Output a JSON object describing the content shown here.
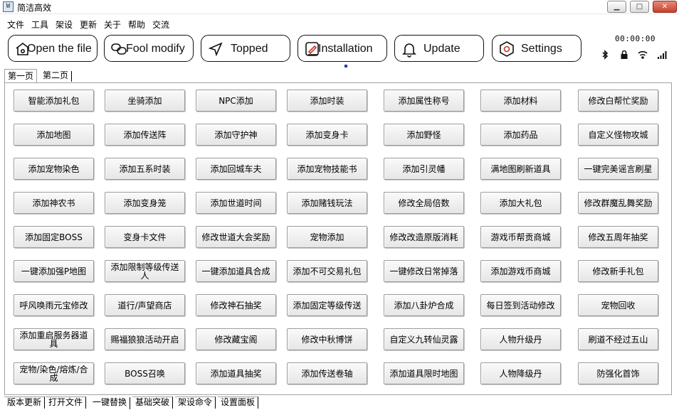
{
  "window": {
    "title": "简洁高效",
    "icon_text": "W",
    "min_label": "▁",
    "max_label": "□",
    "close_label": "✕"
  },
  "menu": [
    "文件",
    "工具",
    "架设",
    "更新",
    "关于",
    "帮助",
    "交流"
  ],
  "toolbar": [
    {
      "label": "Open the file",
      "icon": "folder-icon"
    },
    {
      "label": "Fool modify",
      "icon": "link-icon"
    },
    {
      "label": "Topped",
      "icon": "location-icon"
    },
    {
      "label": "Installation",
      "icon": "edit-icon"
    },
    {
      "label": "Update",
      "icon": "bell-icon"
    },
    {
      "label": "Settings",
      "icon": "hexagon-icon"
    }
  ],
  "status": {
    "time": "00:00:00",
    "icons": [
      "bluetooth-icon",
      "lock-icon",
      "wifi-icon",
      "signal-icon"
    ]
  },
  "top_tabs": [
    "第一页",
    "第二页"
  ],
  "grid": [
    [
      "智能添加礼包",
      "坐骑添加",
      "NPC添加",
      "添加时装",
      "添加属性称号",
      "添加材料",
      "修改白帮忙奖励"
    ],
    [
      "添加地图",
      "添加传送阵",
      "添加守护神",
      "添加变身卡",
      "添加野怪",
      "添加药品",
      "自定义怪物攻城"
    ],
    [
      "添加宠物染色",
      "添加五系时装",
      "添加回城车夫",
      "添加宠物技能书",
      "添加引灵幡",
      "满地图刷新道具",
      "一键完美谣言刷星"
    ],
    [
      "添加神农书",
      "添加变身笼",
      "添加世道时间",
      "添加赌钱玩法",
      "修改全局倍数",
      "添加大礼包",
      "修改群魔乱舞奖励"
    ],
    [
      "添加固定BOSS",
      "变身卡文件",
      "修改世道大会奖励",
      "宠物添加",
      "修改改造原版消耗",
      "游戏币帮贡商城",
      "修改五周年抽奖"
    ],
    [
      "一键添加强P地图",
      "添加限制等级传送人",
      "一键添加道具合成",
      "添加不可交易礼包",
      "一键修改日常掉落",
      "添加游戏币商城",
      "修改新手礼包"
    ],
    [
      "呼风唤雨元宝修改",
      "道行/声望商店",
      "修改神石抽奖",
      "添加固定等级传送",
      "添加八卦炉合成",
      "每日签到活动修改",
      "宠物回收"
    ],
    [
      "添加重启服务器道具",
      "赐福狼狼活动开启",
      "修改藏宝阁",
      "修改中秋博饼",
      "自定义九转仙灵露",
      "人物升级丹",
      "刷道不经过五山"
    ],
    [
      "宠物/染色/熔炼/合成",
      "BOSS召唤",
      "添加道具抽奖",
      "添加传送卷轴",
      "添加道具限时地图",
      "人物降级丹",
      "防强化首饰"
    ]
  ],
  "bottom_tabs": [
    "版本更新",
    "打开文件",
    "一键替换",
    "基础突破",
    "架设命令",
    "设置面板"
  ],
  "bottom_active": 2
}
